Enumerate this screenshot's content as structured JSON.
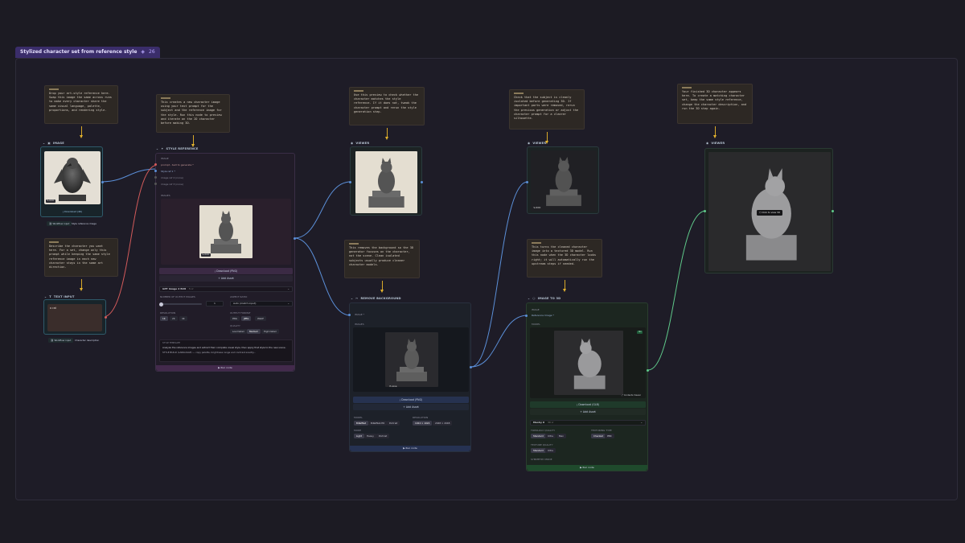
{
  "group": {
    "title": "Stylized character set from reference style",
    "count": "26"
  },
  "notes": {
    "n1": "Drop your art-style reference here. Swap this image the same across runs to make every character share the same visual language, palette, proportions, and rendering style.",
    "n2": "This creates a new character image using your text prompt for the subject and the reference image for the style. Run this node to preview and iterate on the 2D character before making 3D.",
    "n3": "Describe the character you want here. For a set, change only this prompt while keeping the same style reference image in each new character stays in the same art direction.",
    "n4": "Use this preview to check whether the character matches the style reference. If it does not, tweak the character prompt and rerun the style generation step.",
    "n5": "This removes the background so the 3D generator focuses on the character, not the scene. Clean isolated subjects usually produce cleaner character models.",
    "n6": "Check that the subject is cleanly isolated before generating 3D. If important parts were removed, rerun the previous generation or adjust the character prompt for a clearer silhouette.",
    "n7": "This turns the cleaned character image into a textured 3D model. Run this node when the 3D character looks right; it will automatically run the upstream steps if needed.",
    "n8": "Your finished 3D character appears here. To create a matching character set, keep the same style reference, change the character description, and run the 3D step again."
  },
  "image_node": {
    "title": "IMAGE",
    "badge": "S-OOO",
    "download": "Download (4K)",
    "tag_a": "Workflow input",
    "tag_b": "Style reference image"
  },
  "text_node": {
    "title": "TEXT INPUT",
    "value": "a cat",
    "tag_a": "Workflow input",
    "tag_b": "Character description"
  },
  "style_node": {
    "title": "STYLE REFERENCE",
    "ports": [
      "IMAGE",
      "prompt - text to generate *",
      "Style ref 1 *",
      "image ref 2 (none)",
      "image ref 3 (none)"
    ],
    "output_label": "IMAGES",
    "badge": "S-OOO",
    "download": "Download (PNG)",
    "add": "Add Asset",
    "model": "GPT Image 2 Edit",
    "model_sub": "5 cr",
    "count_label": "NUMBER OF OUTPUT IMAGES",
    "count_value": "1",
    "res_label": "RESOLUTION",
    "res_options": [
      "1K",
      "2K",
      "4K"
    ],
    "aspect_label": "ASPECT RATIO",
    "aspect_value": "Auto (match input)",
    "bg_label": "OUTPUT FORMAT",
    "bg_options": [
      "PNG",
      "JPEG",
      "WebP"
    ],
    "quality_label": "QUALITY",
    "quality_options": [
      "Low Detail",
      "Medium",
      "High Detail"
    ],
    "prompt_label": "STYLE TEMPLATE",
    "prompt_text": "Analyze the reference images and extract their complete visual style, then apply that style to the new scene.",
    "prompt_text2": "STYLE BUILD (LANGUAGE) — copy palette, brightness range and contrast exactly...",
    "run": "Run node"
  },
  "viewer1": {
    "title": "VIEWER"
  },
  "bg_node": {
    "title": "REMOVE BACKGROUND",
    "port_in": "IMAGE *",
    "output_label": "IMAGES",
    "badge": "P-none",
    "download": "Download (PNG)",
    "add": "Add Asset",
    "model_label": "MODEL",
    "model_options": [
      "BiRefNet",
      "BiRefNet-HR",
      "Portrait"
    ],
    "res_label": "RESOLUTION",
    "res_options": [
      "1024 × 1024",
      "2048 × 2048"
    ],
    "mode_label": "MODE",
    "mode_options": [
      "Light",
      "Heavy",
      "Portrait"
    ],
    "run": "Run node"
  },
  "viewer2": {
    "title": "VIEWER",
    "badge": "S-OOO"
  },
  "to3d_node": {
    "title": "IMAGE TO 3D",
    "port_a": "IMAGE",
    "port_b": "Reference Image *",
    "output_label": "MODEL",
    "badge": "3D",
    "download": "Download (GLB)",
    "add": "Add Asset",
    "viewer_link": "Contents Viewer",
    "model": "Meshy 6",
    "model_sub": "30 cr",
    "topology_label": "TOPOLOGY QUALITY",
    "topology_options": [
      "Standard",
      "Ultra",
      "Max"
    ],
    "texture_label": "TEXTURING TYPE",
    "texture_options": [
      "Checked",
      "PBR"
    ],
    "quality_label": "TEXTURE QUALITY",
    "quality_options": [
      "Standard",
      "Ultra"
    ],
    "symmetry_label": "SYMMETRY MODE",
    "run": "Run node"
  },
  "viewer3": {
    "title": "VIEWER",
    "click_hint": "Click to view 3D"
  },
  "colors": {
    "accent": "#5a3fb0",
    "style_node": "#3a2a4a",
    "bg_node": "#26324a",
    "to3d_node": "#234a2f",
    "note": "#2d2824",
    "wire_yellow": "#e3b22e"
  }
}
